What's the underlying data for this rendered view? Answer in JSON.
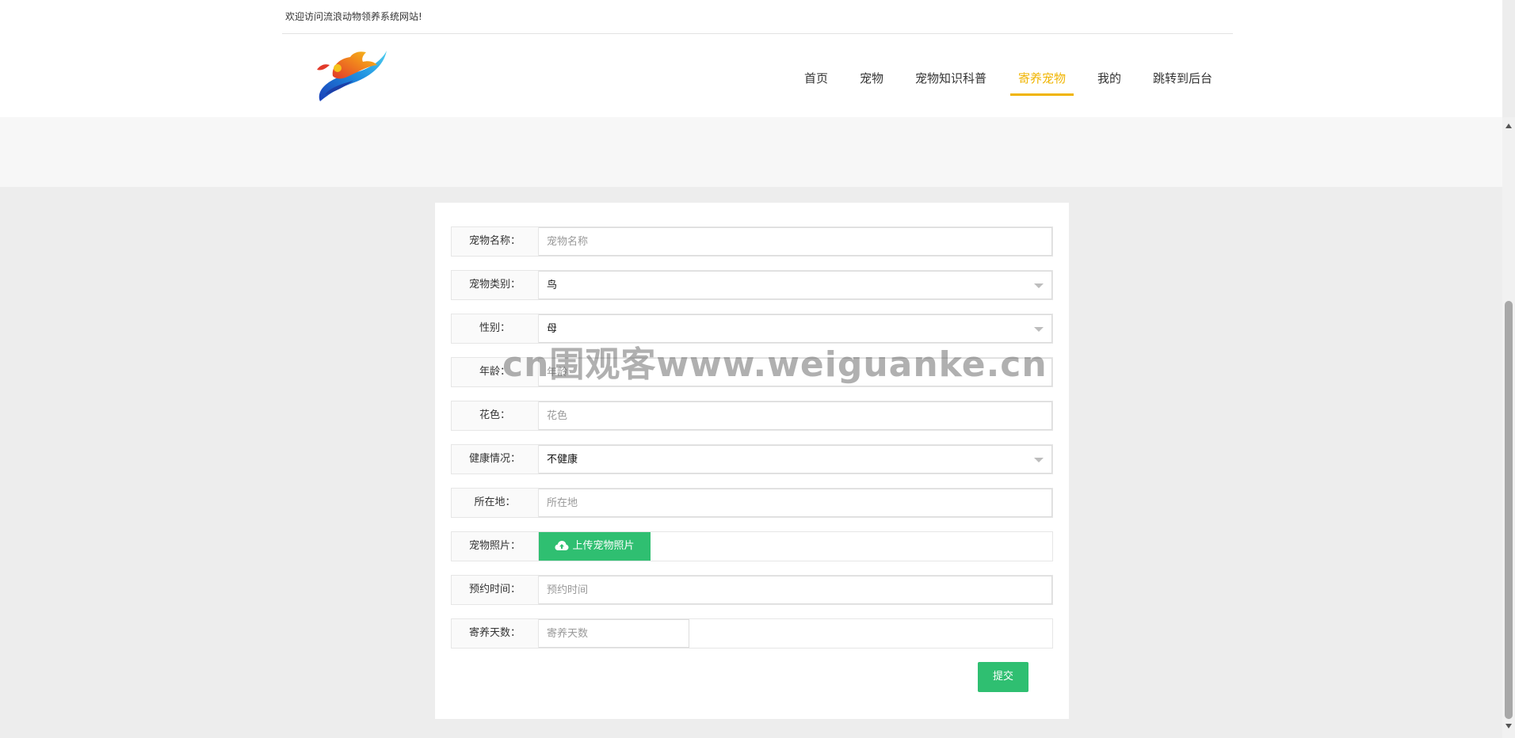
{
  "header": {
    "welcome": "欢迎访问流浪动物领养系统网站!"
  },
  "nav": {
    "items": [
      {
        "label": "首页"
      },
      {
        "label": "宠物"
      },
      {
        "label": "宠物知识科普"
      },
      {
        "label": "寄养宠物",
        "active": true
      },
      {
        "label": "我的"
      },
      {
        "label": "跳转到后台"
      }
    ],
    "active_color": "#f0b400"
  },
  "form": {
    "fields": [
      {
        "label": "宠物名称：",
        "placeholder": "宠物名称",
        "value": ""
      },
      {
        "label": "宠物类别：",
        "value": "鸟"
      },
      {
        "label": "性别：",
        "value": "母"
      },
      {
        "label": "年龄：",
        "placeholder": "年龄",
        "value": ""
      },
      {
        "label": "花色：",
        "placeholder": "花色",
        "value": ""
      },
      {
        "label": "健康情况：",
        "value": "不健康"
      },
      {
        "label": "所在地：",
        "placeholder": "所在地",
        "value": ""
      },
      {
        "label": "宠物照片：",
        "button": "上传宠物照片"
      },
      {
        "label": "预约时间：",
        "placeholder": "预约时间",
        "value": ""
      },
      {
        "label": "寄养天数：",
        "placeholder": "寄养天数",
        "value": ""
      }
    ],
    "submit_label": "提交",
    "button_color": "#2fbf71"
  },
  "watermark": "cn围观客www.weiguanke.cn"
}
